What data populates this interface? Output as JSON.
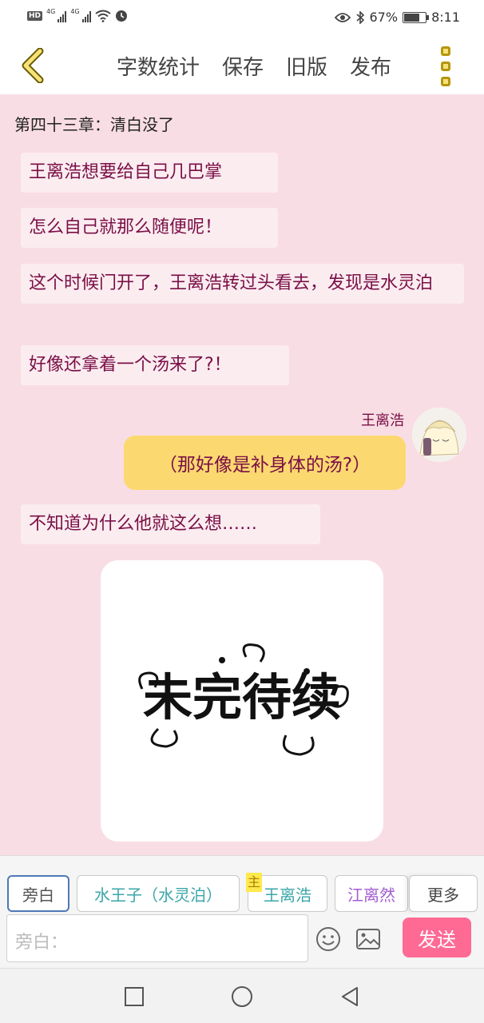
{
  "status_bar": {
    "hd": "HD",
    "net1": "4G",
    "net2": "4G",
    "battery_percent": "67%",
    "time": "8:11"
  },
  "toolbar": {
    "back_icon": "chevron-left-icon",
    "word_count_label": "字数统计",
    "save_label": "保存",
    "old_version_label": "旧版",
    "publish_label": "发布",
    "menu_icon": "vertical-dots-icon"
  },
  "chat": {
    "chapter_title": "第四十三章：清白没了",
    "messages": [
      {
        "type": "narration",
        "text": "王离浩想要给自己几巴掌"
      },
      {
        "type": "narration",
        "text": "怎么自己就那么随便呢！"
      },
      {
        "type": "narration",
        "text": "这个时候门开了，王离浩转过头看去，发现是水灵泊"
      },
      {
        "type": "narration",
        "text": "好像还拿着一个汤来了?！"
      },
      {
        "type": "character",
        "name": "王离浩",
        "text": "（那好像是补身体的汤?）"
      },
      {
        "type": "narration",
        "text": "不知道为什么他就这么想……"
      }
    ],
    "image_text": "未完待续"
  },
  "characters": {
    "items": [
      {
        "label": "旁白",
        "color": "#555555"
      },
      {
        "label": "水王子（水灵泊）",
        "color": "#3aa6a8"
      },
      {
        "label": "王离浩",
        "color": "#3aa6a8",
        "badge": "主"
      },
      {
        "label": "江离然",
        "color": "#a45dd0"
      }
    ],
    "more_label": "更多"
  },
  "input": {
    "placeholder": "旁白：",
    "emoji_icon": "emoji-icon",
    "image_icon": "image-icon",
    "send_label": "发送"
  },
  "navbar": {
    "recent_icon": "square-icon",
    "home_icon": "circle-icon",
    "back_icon": "triangle-back-icon"
  },
  "colors": {
    "chat_background": "#f9dde4",
    "narration_text": "#7a0f46",
    "character_bubble": "#fbd970",
    "send_button": "#ff6a95",
    "menu_accent": "#b5960e"
  }
}
